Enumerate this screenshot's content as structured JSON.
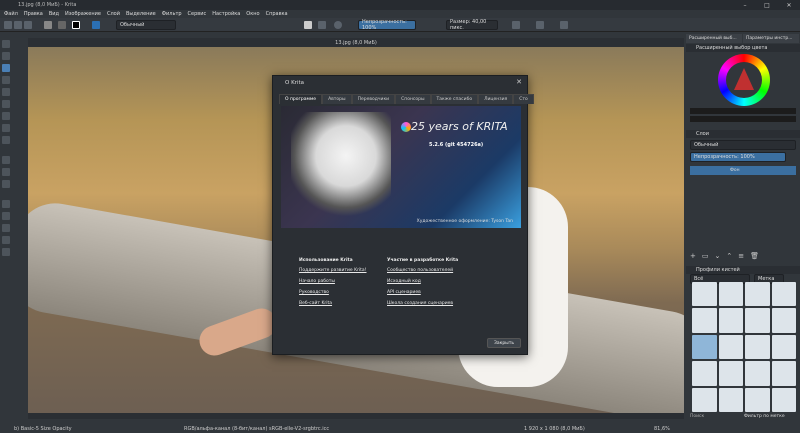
{
  "window": {
    "title": "13.jpg (8,0 МиБ) - Krita"
  },
  "menu": [
    "Файл",
    "Правка",
    "Вид",
    "Изображение",
    "Слой",
    "Выделение",
    "Фильтр",
    "Сервис",
    "Настройка",
    "Окно",
    "Справка"
  ],
  "toolbar": {
    "blend_mode": "Обычный",
    "opacity": "Непрозрачность: 100%",
    "size": "Размер: 40,00 пикс."
  },
  "document": {
    "tab_title": "13.jpg (8,0 МиБ)"
  },
  "dock": {
    "tab1": "Расширенный выб...",
    "tab2": "Параметры инстр...",
    "color_header": "Расширенный выбор цвета",
    "layers_header": "Слои",
    "layers_blend": "Обычный",
    "layers_opacity": "Непрозрачность: 100%",
    "layer_name": "Фон",
    "brushes_header": "Профили кистей",
    "brushes_filter": "Всё",
    "brushes_tag": "Метка",
    "search": "Поиск",
    "filter_tag": "Фильтр по метке"
  },
  "status": {
    "left": "b) Basic-5 Size Opacity",
    "middle": "RGB/альфа-канал (8-бит/канал) sRGB-elle-V2-srgbtrc.icc",
    "right": "1 920 x 1 080 (8,0 МиБ)",
    "zoom": "81,6%"
  },
  "dialog": {
    "title": "О Krita",
    "tabs": [
      "О программе",
      "Авторы",
      "Переводчики",
      "Спонсоры",
      "Также спасибо",
      "Лицензия",
      "Сто"
    ],
    "splash_title": "25 years of KRITA",
    "splash_version": "5.2.6 (git 454726a)",
    "splash_credit": "Художественное оформление: Tyson Tan",
    "col1": {
      "heading": "Использование Krita",
      "links": [
        "Поддержите развитие Krita!",
        "Начало работы",
        "Руководство",
        "Веб-сайт Krita"
      ]
    },
    "col2": {
      "heading": "Участие в разработке Krita",
      "links": [
        "Сообщество пользователей",
        "Исходный код",
        "API сценариев",
        "Школа создания сценариев"
      ]
    },
    "close": "Закрыть"
  }
}
